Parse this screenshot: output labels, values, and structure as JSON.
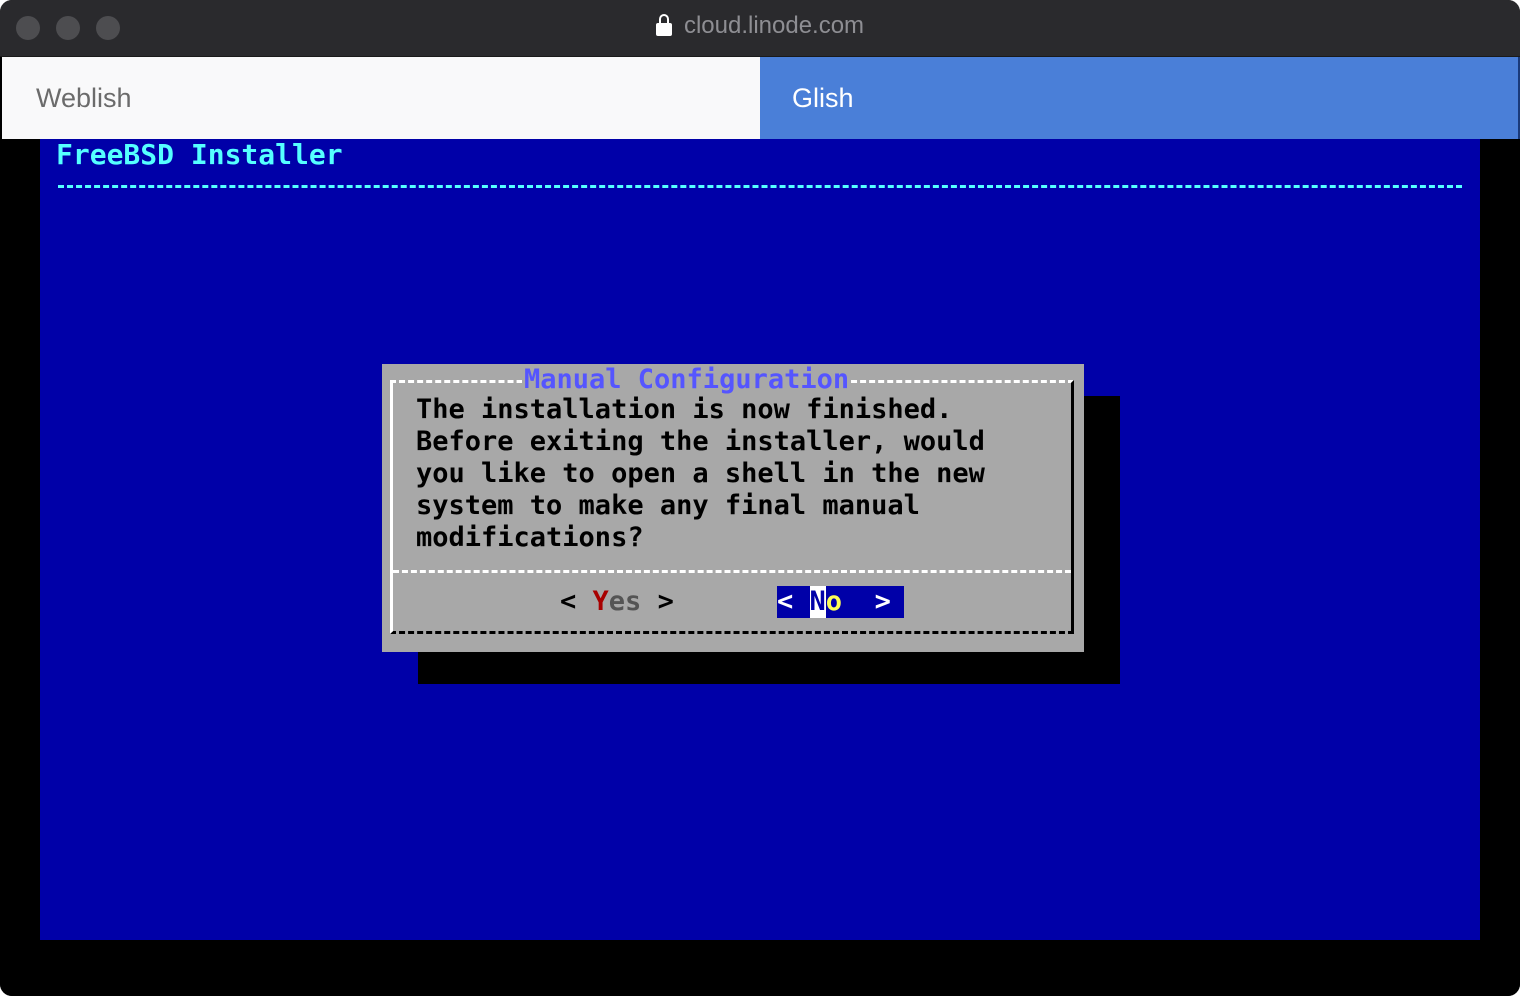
{
  "browser": {
    "url": "cloud.linode.com"
  },
  "tabs": [
    {
      "label": "Weblish",
      "active": false
    },
    {
      "label": "Glish",
      "active": true
    }
  ],
  "console": {
    "header_title": "FreeBSD Installer",
    "dialog": {
      "title": "Manual Configuration",
      "message_lines": [
        "The installation is now finished.",
        "Before exiting the installer, would",
        "you like to open a shell in the new",
        "system to make any final manual",
        "modifications?"
      ],
      "yes_button": {
        "left_bracket": "<",
        "hotkey": "Y",
        "rest": "es",
        "right_bracket": ">"
      },
      "no_button": {
        "left_bracket": "<",
        "hotkey": "N",
        "rest": "o",
        "right_bracket": ">",
        "selected": true
      }
    }
  },
  "colors": {
    "console_background": "#0000a8",
    "dialog_background": "#a8a8a8",
    "title_text": "#55ffff",
    "dialog_title": "#5555ff",
    "active_tab": "#4a7fd8"
  }
}
